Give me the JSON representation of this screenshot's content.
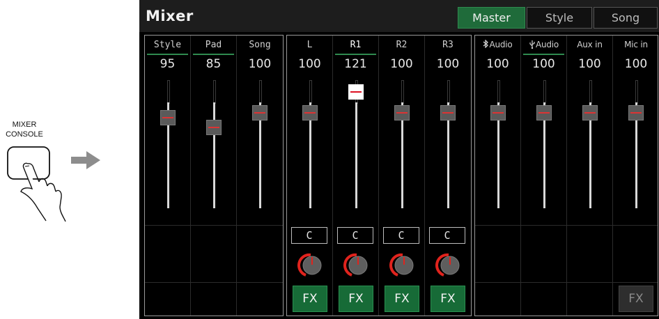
{
  "illustration": {
    "label_line1": "MIXER",
    "label_line2": "CONSOLE",
    "icons": [
      "finger-press-icon",
      "arrow-right-icon"
    ]
  },
  "app": {
    "title": "Mixer"
  },
  "tabs": [
    {
      "label": "Master",
      "active": true
    },
    {
      "label": "Style",
      "active": false
    },
    {
      "label": "Song",
      "active": false
    }
  ],
  "groups": [
    {
      "channels": [
        {
          "label": "Style",
          "value": "95",
          "level": 95,
          "underline": true
        },
        {
          "label": "Pad",
          "value": "85",
          "level": 85,
          "underline": true
        },
        {
          "label": "Song",
          "value": "100",
          "level": 100,
          "underline": false
        }
      ]
    },
    {
      "channels": [
        {
          "label": "L",
          "value": "100",
          "level": 100,
          "underline": false,
          "pan": "C",
          "fx": "FX"
        },
        {
          "label": "R1",
          "value": "121",
          "level": 121,
          "underline": true,
          "selected": true,
          "pan": "C",
          "fx": "FX"
        },
        {
          "label": "R2",
          "value": "100",
          "level": 100,
          "underline": false,
          "pan": "C",
          "fx": "FX"
        },
        {
          "label": "R3",
          "value": "100",
          "level": 100,
          "underline": false,
          "pan": "C",
          "fx": "FX"
        }
      ]
    },
    {
      "channels": [
        {
          "label": "Audio",
          "icon": "bluetooth-icon",
          "value": "100",
          "level": 100,
          "underline": false
        },
        {
          "label": "Audio",
          "icon": "usb-icon",
          "value": "100",
          "level": 100,
          "underline": true
        },
        {
          "label": "Aux in",
          "value": "100",
          "level": 100,
          "underline": false
        },
        {
          "label": "Mic in",
          "value": "100",
          "level": 100,
          "underline": false,
          "fx": "FX"
        }
      ]
    }
  ],
  "colors": {
    "accent_green": "#2f8a4f",
    "knob_red": "#d33"
  }
}
